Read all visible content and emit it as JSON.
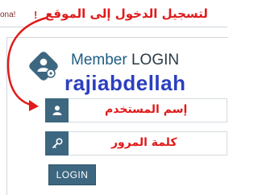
{
  "top_bar": {
    "notice_text": "ona!",
    "notice_mark": "!",
    "annotation_title": "لتسجيل الدخول إلى الموقع"
  },
  "login": {
    "heading_member": "Member",
    "heading_login": "LOGIN",
    "logo_icon": "person-key-icon",
    "watermark_name": "rajiabdellah",
    "username": {
      "icon": "user-icon",
      "value": "",
      "label": "إسم المستخدم"
    },
    "password": {
      "icon": "key-icon",
      "value": "",
      "label": "كلمة المرور"
    },
    "button_label": "LOGIN"
  },
  "colors": {
    "brand_teal": "#3d6780",
    "heading_blue": "#1f5c84",
    "annotation_red": "#e01a1a",
    "watermark_blue": "#2b3fbf"
  }
}
